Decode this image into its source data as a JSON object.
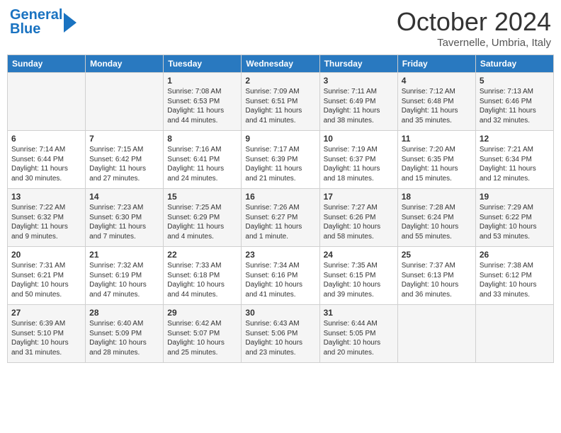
{
  "header": {
    "logo_line1": "General",
    "logo_line2": "Blue",
    "month": "October 2024",
    "location": "Tavernelle, Umbria, Italy"
  },
  "days_of_week": [
    "Sunday",
    "Monday",
    "Tuesday",
    "Wednesday",
    "Thursday",
    "Friday",
    "Saturday"
  ],
  "weeks": [
    [
      {
        "day": "",
        "sunrise": "",
        "sunset": "",
        "daylight": ""
      },
      {
        "day": "",
        "sunrise": "",
        "sunset": "",
        "daylight": ""
      },
      {
        "day": "1",
        "sunrise": "Sunrise: 7:08 AM",
        "sunset": "Sunset: 6:53 PM",
        "daylight": "Daylight: 11 hours and 44 minutes."
      },
      {
        "day": "2",
        "sunrise": "Sunrise: 7:09 AM",
        "sunset": "Sunset: 6:51 PM",
        "daylight": "Daylight: 11 hours and 41 minutes."
      },
      {
        "day": "3",
        "sunrise": "Sunrise: 7:11 AM",
        "sunset": "Sunset: 6:49 PM",
        "daylight": "Daylight: 11 hours and 38 minutes."
      },
      {
        "day": "4",
        "sunrise": "Sunrise: 7:12 AM",
        "sunset": "Sunset: 6:48 PM",
        "daylight": "Daylight: 11 hours and 35 minutes."
      },
      {
        "day": "5",
        "sunrise": "Sunrise: 7:13 AM",
        "sunset": "Sunset: 6:46 PM",
        "daylight": "Daylight: 11 hours and 32 minutes."
      }
    ],
    [
      {
        "day": "6",
        "sunrise": "Sunrise: 7:14 AM",
        "sunset": "Sunset: 6:44 PM",
        "daylight": "Daylight: 11 hours and 30 minutes."
      },
      {
        "day": "7",
        "sunrise": "Sunrise: 7:15 AM",
        "sunset": "Sunset: 6:42 PM",
        "daylight": "Daylight: 11 hours and 27 minutes."
      },
      {
        "day": "8",
        "sunrise": "Sunrise: 7:16 AM",
        "sunset": "Sunset: 6:41 PM",
        "daylight": "Daylight: 11 hours and 24 minutes."
      },
      {
        "day": "9",
        "sunrise": "Sunrise: 7:17 AM",
        "sunset": "Sunset: 6:39 PM",
        "daylight": "Daylight: 11 hours and 21 minutes."
      },
      {
        "day": "10",
        "sunrise": "Sunrise: 7:19 AM",
        "sunset": "Sunset: 6:37 PM",
        "daylight": "Daylight: 11 hours and 18 minutes."
      },
      {
        "day": "11",
        "sunrise": "Sunrise: 7:20 AM",
        "sunset": "Sunset: 6:35 PM",
        "daylight": "Daylight: 11 hours and 15 minutes."
      },
      {
        "day": "12",
        "sunrise": "Sunrise: 7:21 AM",
        "sunset": "Sunset: 6:34 PM",
        "daylight": "Daylight: 11 hours and 12 minutes."
      }
    ],
    [
      {
        "day": "13",
        "sunrise": "Sunrise: 7:22 AM",
        "sunset": "Sunset: 6:32 PM",
        "daylight": "Daylight: 11 hours and 9 minutes."
      },
      {
        "day": "14",
        "sunrise": "Sunrise: 7:23 AM",
        "sunset": "Sunset: 6:30 PM",
        "daylight": "Daylight: 11 hours and 7 minutes."
      },
      {
        "day": "15",
        "sunrise": "Sunrise: 7:25 AM",
        "sunset": "Sunset: 6:29 PM",
        "daylight": "Daylight: 11 hours and 4 minutes."
      },
      {
        "day": "16",
        "sunrise": "Sunrise: 7:26 AM",
        "sunset": "Sunset: 6:27 PM",
        "daylight": "Daylight: 11 hours and 1 minute."
      },
      {
        "day": "17",
        "sunrise": "Sunrise: 7:27 AM",
        "sunset": "Sunset: 6:26 PM",
        "daylight": "Daylight: 10 hours and 58 minutes."
      },
      {
        "day": "18",
        "sunrise": "Sunrise: 7:28 AM",
        "sunset": "Sunset: 6:24 PM",
        "daylight": "Daylight: 10 hours and 55 minutes."
      },
      {
        "day": "19",
        "sunrise": "Sunrise: 7:29 AM",
        "sunset": "Sunset: 6:22 PM",
        "daylight": "Daylight: 10 hours and 53 minutes."
      }
    ],
    [
      {
        "day": "20",
        "sunrise": "Sunrise: 7:31 AM",
        "sunset": "Sunset: 6:21 PM",
        "daylight": "Daylight: 10 hours and 50 minutes."
      },
      {
        "day": "21",
        "sunrise": "Sunrise: 7:32 AM",
        "sunset": "Sunset: 6:19 PM",
        "daylight": "Daylight: 10 hours and 47 minutes."
      },
      {
        "day": "22",
        "sunrise": "Sunrise: 7:33 AM",
        "sunset": "Sunset: 6:18 PM",
        "daylight": "Daylight: 10 hours and 44 minutes."
      },
      {
        "day": "23",
        "sunrise": "Sunrise: 7:34 AM",
        "sunset": "Sunset: 6:16 PM",
        "daylight": "Daylight: 10 hours and 41 minutes."
      },
      {
        "day": "24",
        "sunrise": "Sunrise: 7:35 AM",
        "sunset": "Sunset: 6:15 PM",
        "daylight": "Daylight: 10 hours and 39 minutes."
      },
      {
        "day": "25",
        "sunrise": "Sunrise: 7:37 AM",
        "sunset": "Sunset: 6:13 PM",
        "daylight": "Daylight: 10 hours and 36 minutes."
      },
      {
        "day": "26",
        "sunrise": "Sunrise: 7:38 AM",
        "sunset": "Sunset: 6:12 PM",
        "daylight": "Daylight: 10 hours and 33 minutes."
      }
    ],
    [
      {
        "day": "27",
        "sunrise": "Sunrise: 6:39 AM",
        "sunset": "Sunset: 5:10 PM",
        "daylight": "Daylight: 10 hours and 31 minutes."
      },
      {
        "day": "28",
        "sunrise": "Sunrise: 6:40 AM",
        "sunset": "Sunset: 5:09 PM",
        "daylight": "Daylight: 10 hours and 28 minutes."
      },
      {
        "day": "29",
        "sunrise": "Sunrise: 6:42 AM",
        "sunset": "Sunset: 5:07 PM",
        "daylight": "Daylight: 10 hours and 25 minutes."
      },
      {
        "day": "30",
        "sunrise": "Sunrise: 6:43 AM",
        "sunset": "Sunset: 5:06 PM",
        "daylight": "Daylight: 10 hours and 23 minutes."
      },
      {
        "day": "31",
        "sunrise": "Sunrise: 6:44 AM",
        "sunset": "Sunset: 5:05 PM",
        "daylight": "Daylight: 10 hours and 20 minutes."
      },
      {
        "day": "",
        "sunrise": "",
        "sunset": "",
        "daylight": ""
      },
      {
        "day": "",
        "sunrise": "",
        "sunset": "",
        "daylight": ""
      }
    ]
  ]
}
